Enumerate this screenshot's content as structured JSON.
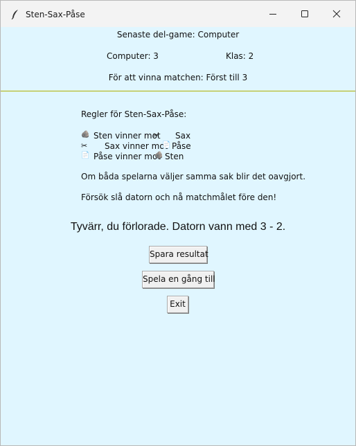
{
  "window": {
    "title": "Sten-Sax-Påse"
  },
  "status": {
    "last_round": "Senaste del-game: Computer",
    "computer_score": "Computer: 3",
    "player_score": "Klas: 2",
    "goal": "För att vinna matchen: Först till 3"
  },
  "rules": {
    "heading": "Regler för Sten-Sax-Påse:",
    "rows": [
      {
        "left_icon": "rock-icon",
        "text": "Sten vinner mot",
        "mid_icon": "scissors-icon",
        "target": "Sax"
      },
      {
        "left_icon": "scissors-icon",
        "text": "Sax vinner mot",
        "mid_icon": "paper-icon",
        "target": "Påse"
      },
      {
        "left_icon": "paper-icon",
        "text": "Påse vinner mot",
        "mid_icon": "rock-icon",
        "target": "Sten"
      }
    ],
    "draw_note": "Om båda spelarna väljer samma sak blir det oavgjort.",
    "goal_note": "Försök slå datorn och nå matchmålet före den!"
  },
  "result": {
    "message": "Tyvärr, du förlorade. Datorn vann med 3 - 2."
  },
  "buttons": {
    "save": "Spara resultat",
    "play_again": "Spela en gång till",
    "exit": "Exit"
  },
  "colors": {
    "background": "#e0f6ff",
    "divider": "#b0b000",
    "titlebar": "#f3f3f3"
  }
}
